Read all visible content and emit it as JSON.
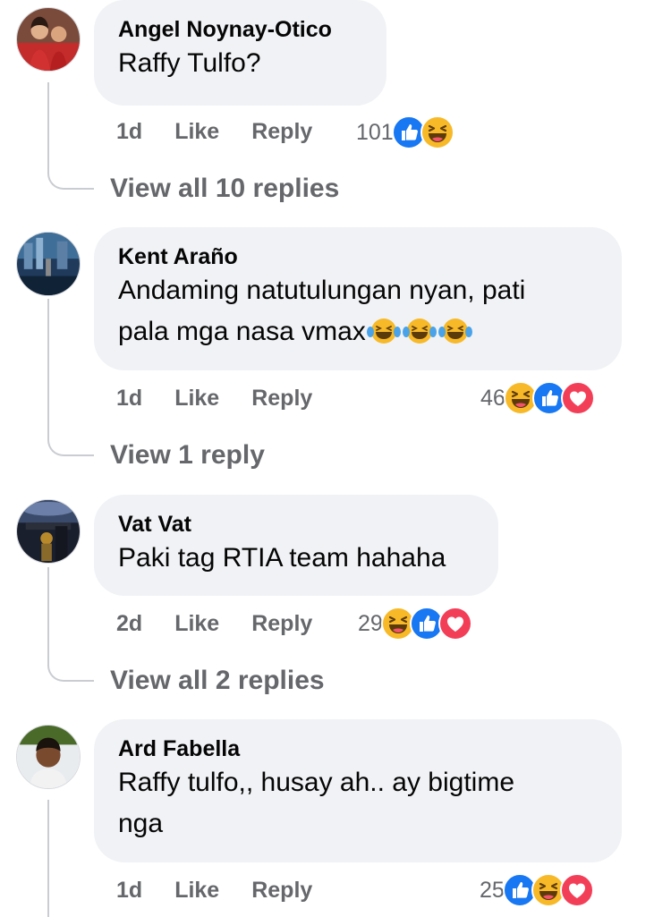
{
  "comments": [
    {
      "author": "Angel Noynay-Otico",
      "text": "Raffy Tulfo?",
      "time": "1d",
      "like_label": "Like",
      "reply_label": "Reply",
      "reaction_count": "101",
      "reactions": [
        "like-icon",
        "haha-icon"
      ],
      "view_replies": "View all 10 replies"
    },
    {
      "author": "Kent Araño",
      "text_line1": "Andaming natutulungan nyan, pati",
      "text_line2": "pala mga nasa vmax",
      "text_emoji": [
        "laugh-crying-emoji",
        "laugh-crying-emoji",
        "laugh-crying-emoji"
      ],
      "time": "1d",
      "like_label": "Like",
      "reply_label": "Reply",
      "reaction_count": "46",
      "reactions": [
        "haha-icon",
        "like-icon",
        "love-icon"
      ],
      "view_replies": "View 1 reply"
    },
    {
      "author": "Vat Vat",
      "text": "Paki tag RTIA team hahaha",
      "time": "2d",
      "like_label": "Like",
      "reply_label": "Reply",
      "reaction_count": "29",
      "reactions": [
        "haha-icon",
        "like-icon",
        "love-icon"
      ],
      "view_replies": "View all 2 replies"
    },
    {
      "author": "Ard Fabella",
      "text_line1": "Raffy tulfo,, husay ah.. ay bigtime",
      "text_line2": "nga",
      "time": "1d",
      "like_label": "Like",
      "reply_label": "Reply",
      "reaction_count": "25",
      "reactions": [
        "like-icon",
        "haha-icon",
        "love-icon"
      ]
    }
  ],
  "colors": {
    "bubble": "#f0f2f5",
    "secondary_text": "#65676b",
    "like_blue": "#1877f2",
    "haha_yellow": "#f7b928",
    "love_red": "#f33e58",
    "thread_line": "#c9ccd1"
  }
}
